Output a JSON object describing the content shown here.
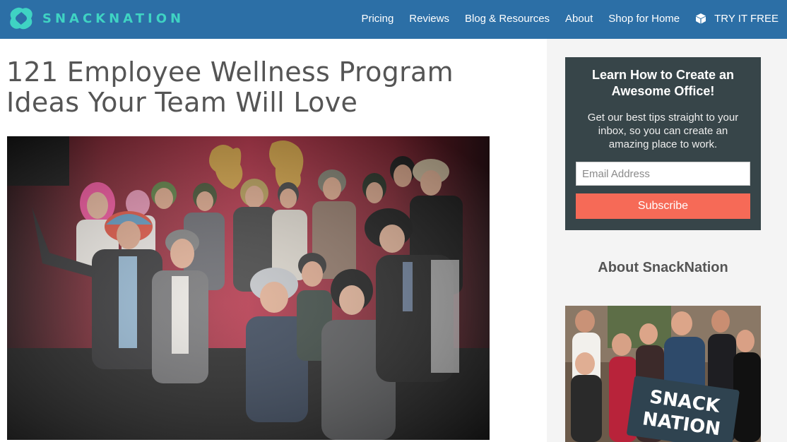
{
  "header": {
    "logo_text": "SNACKNATION",
    "nav": [
      {
        "label": "Pricing"
      },
      {
        "label": "Reviews"
      },
      {
        "label": "Blog & Resources"
      },
      {
        "label": "About"
      },
      {
        "label": "Shop for Home"
      }
    ],
    "cta": {
      "label": "TRY IT FREE",
      "icon": "box-icon"
    }
  },
  "article": {
    "title_line1": "121 Employee Wellness Program",
    "title_line2": "Ideas Your Team Will Love"
  },
  "sidebar": {
    "signup": {
      "title_line1": "Learn How to Create an",
      "title_line2": "Awesome Office!",
      "body_line1": "Get our best tips straight to your",
      "body_line2": "inbox, so you can create an",
      "body_line3": "amazing place to work.",
      "email_placeholder": "Email Address",
      "subscribe_label": "Subscribe"
    },
    "about_heading": "About SnackNation",
    "sign_text_line1": "SNACK",
    "sign_text_line2": "NATION"
  },
  "colors": {
    "header_bg": "#2c6fa6",
    "logo": "#3fd3c3",
    "signup_bg": "#374549",
    "subscribe": "#f66a57"
  }
}
